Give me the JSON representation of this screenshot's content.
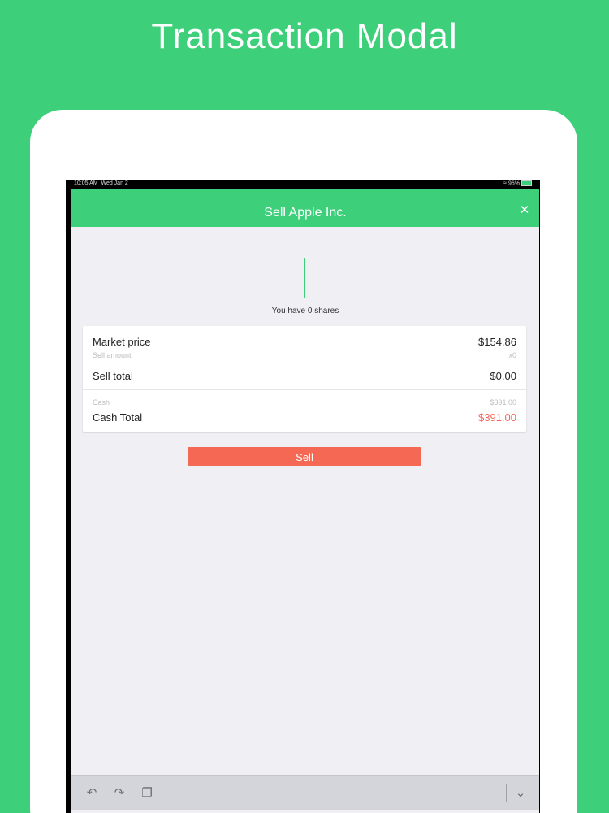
{
  "headline": "Transaction Modal",
  "status_bar": {
    "time": "10:05 AM",
    "date": "Wed Jan 2",
    "battery": "96%"
  },
  "modal": {
    "title": "Sell Apple Inc.",
    "close_icon": "close-icon"
  },
  "position": {
    "shares_text": "You have 0 shares"
  },
  "summary": {
    "market_price_label": "Market price",
    "market_price_value": "$154.86",
    "sell_amount_label": "Sell amount",
    "sell_amount_value": "x0",
    "sell_total_label": "Sell total",
    "sell_total_value": "$0.00",
    "cash_label": "Cash",
    "cash_value": "$391.00",
    "cash_total_label": "Cash Total",
    "cash_total_value": "$391.00"
  },
  "actions": {
    "sell_label": "Sell"
  },
  "keyboard_toolbar": {
    "icons": [
      "undo-icon",
      "redo-icon",
      "paste-icon",
      "chevron-down-icon"
    ]
  },
  "colors": {
    "brand_green": "#3ecf7a",
    "sell_red": "#f56854",
    "modal_background": "#efeff4"
  }
}
